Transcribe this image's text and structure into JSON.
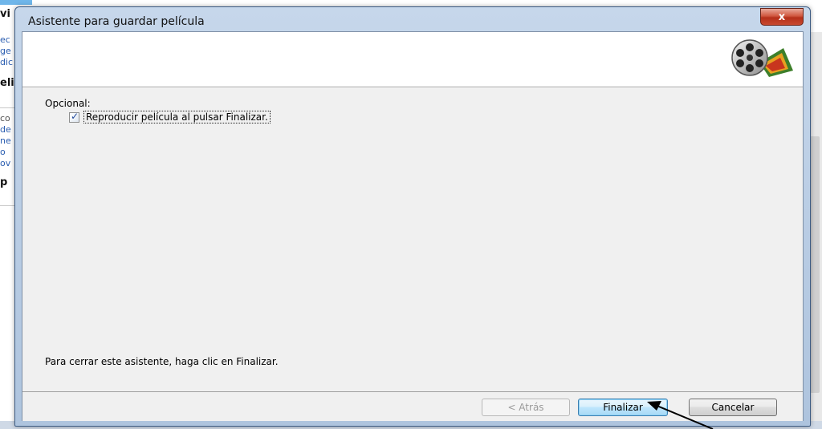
{
  "background_app": {
    "lines": [
      "ec",
      "ge",
      "dic",
      "eli",
      "co",
      "de",
      "ne",
      "o",
      "ov",
      "p"
    ],
    "title_fragment": "vi"
  },
  "dialog": {
    "title": "Asistente para guardar película",
    "close_label": "x",
    "optional_label": "Opcional:",
    "checkbox": {
      "label": "Reproducir película al pulsar Finalizar.",
      "checked": true
    },
    "instruction": "Para cerrar este asistente, haga clic en Finalizar.",
    "buttons": {
      "back": "< Atrás",
      "finish": "Finalizar",
      "cancel": "Cancelar"
    }
  },
  "colors": {
    "window_frame": "#b7cbe3",
    "close_button": "#c8492f",
    "default_button": "#bee6fd"
  },
  "icons": {
    "header": "movie-film-reel-icon",
    "close": "close-icon",
    "check": "check-icon",
    "annotation": "arrow-pointer-icon"
  }
}
